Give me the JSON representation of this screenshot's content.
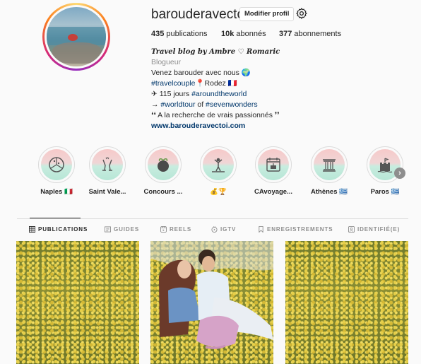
{
  "profile": {
    "username": "barouderavectoi",
    "edit_label": "Modifier profil",
    "stats": {
      "publications_count": "435",
      "publications_label": "publications",
      "followers_count": "10k",
      "followers_label": "abonnés",
      "following_count": "377",
      "following_label": "abonnements"
    },
    "bio": {
      "full_name": "Travel blog by Ambre ♡ Romaric",
      "category": "Blogueur",
      "line1": "Venez barouder avec nous 🌍",
      "line2_tag": "#travelcouple",
      "line2_rest": "📍Rodez 🇫🇷",
      "line3_prefix": "✈ 115 jours ",
      "line3_tag": "#aroundtheworld",
      "line4_prefix": "→ ",
      "line4_tag1": "#worldtour",
      "line4_mid": " of ",
      "line4_tag2": "#sevenwonders",
      "line5": "❛❛ A la recherche de vrais passionnés ❜❜",
      "website": "www.barouderavectoi.com"
    }
  },
  "highlights": [
    {
      "label": "Naples 🇮🇹",
      "icon": "pizza-icon"
    },
    {
      "label": "Saint Vale...",
      "icon": "champagne-icon"
    },
    {
      "label": "Concours ...",
      "icon": "gift-icon"
    },
    {
      "label": "💰🏆",
      "icon": "trophy-person-icon"
    },
    {
      "label": "CAvoyage...",
      "icon": "calendar-cake-icon"
    },
    {
      "label": "Athènes 🇬🇷",
      "icon": "column-icon"
    },
    {
      "label": "Paros 🇬🇷",
      "icon": "castle-icon"
    }
  ],
  "tabs": [
    {
      "label": "PUBLICATIONS",
      "icon": "grid-icon",
      "active": true
    },
    {
      "label": "GUIDES",
      "icon": "guide-icon",
      "active": false
    },
    {
      "label": "REELS",
      "icon": "reels-icon",
      "active": false
    },
    {
      "label": "IGTV",
      "icon": "igtv-icon",
      "active": false
    },
    {
      "label": "ENREGISTREMENTS",
      "icon": "bookmark-icon",
      "active": false
    },
    {
      "label": "IDENTIFIÉ(E)",
      "icon": "tagged-icon",
      "active": false
    }
  ],
  "colors": {
    "accent_link": "#00376b",
    "muted": "#8e8e8e",
    "text": "#262626"
  }
}
